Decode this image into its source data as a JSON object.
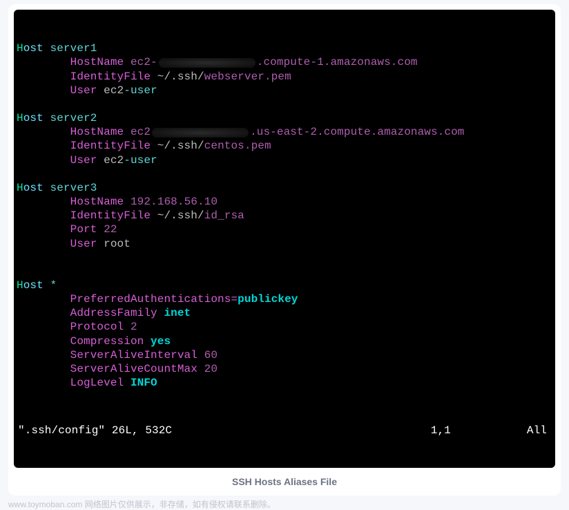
{
  "hosts": [
    {
      "label": " server1",
      "lines": [
        {
          "key": "HostName",
          "prefix": " ec2-",
          "redacted": true,
          "suffix": ".compute-1.amazonaws.com"
        },
        {
          "key": "IdentityFile",
          "gray": " ~/.ssh/",
          "magenta": "webserver.pem"
        },
        {
          "key": "User",
          "gray": " ec2",
          "teal": "-user"
        }
      ]
    },
    {
      "label": " server2",
      "lines": [
        {
          "key": "HostName",
          "prefix": " ec2",
          "redacted": true,
          "suffix": ".us-east-2.compute.amazonaws.com"
        },
        {
          "key": "IdentityFile",
          "gray": " ~/.ssh/",
          "magenta": "centos.pem"
        },
        {
          "key": "User",
          "gray": " ec2",
          "teal": "-user"
        }
      ]
    },
    {
      "label": " server3",
      "lines": [
        {
          "key": "HostName",
          "magenta": " 192.168.56.10"
        },
        {
          "key": "IdentityFile",
          "gray": " ~/.ssh/",
          "magenta": "id_rsa"
        },
        {
          "key": "Port",
          "magenta": " 22"
        },
        {
          "key": "User",
          "gray": " root"
        }
      ]
    },
    {
      "label": " *",
      "blank_before": true,
      "lines": [
        {
          "key": "PreferredAuthentications=",
          "cyan": "publickey",
          "nosep": true
        },
        {
          "key": "AddressFamily",
          "cyan": " inet"
        },
        {
          "key": "Protocol",
          "magenta": " 2"
        },
        {
          "key": "Compression",
          "cyan": " yes"
        },
        {
          "key": "ServerAliveInterval",
          "magenta": " 60"
        },
        {
          "key": "ServerAliveCountMax",
          "magenta": " 20"
        },
        {
          "key": "LogLevel",
          "cyan": " INFO"
        }
      ]
    }
  ],
  "status": {
    "file": "\".ssh/config\" 26L, 532C",
    "pos": "1,1",
    "mode": "All"
  },
  "caption": "SSH Hosts Aliases File",
  "footer": "www.toymoban.com 网络图片仅供展示，非存储，如有侵权请联系删除。",
  "keyword": {
    "h": "H",
    "ost": "ost"
  },
  "indent": "        "
}
